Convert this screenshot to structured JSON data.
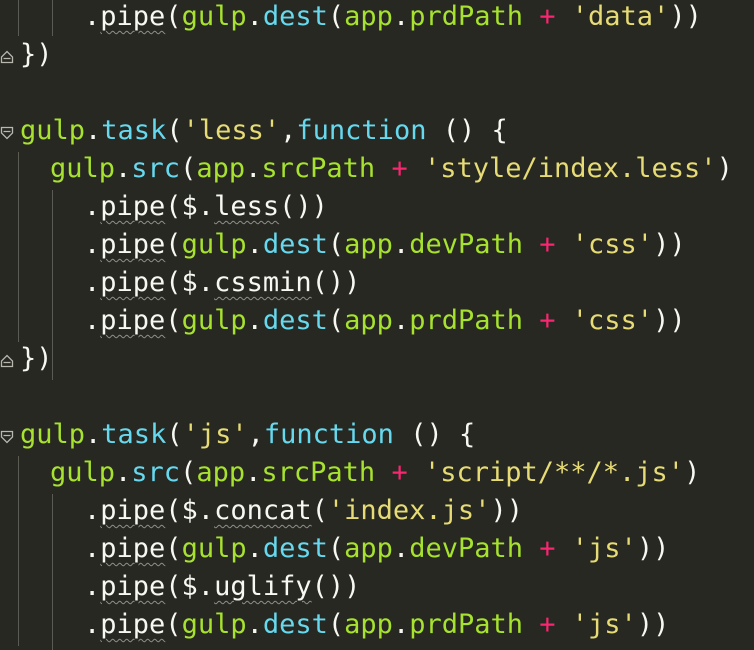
{
  "colors": {
    "background": "#272822",
    "identifier": "#a6e22e",
    "keyword": "#66d9ef",
    "string": "#e6db74",
    "operator": "#f92672",
    "plain": "#f8f8f2"
  },
  "lines": [
    [
      {
        "t": ".",
        "c": "plain"
      },
      {
        "t": "pipe",
        "c": "plain",
        "u": true
      },
      {
        "t": "(",
        "c": "plain"
      },
      {
        "t": "gulp",
        "c": "green"
      },
      {
        "t": ".",
        "c": "plain"
      },
      {
        "t": "dest",
        "c": "cyan"
      },
      {
        "t": "(",
        "c": "plain"
      },
      {
        "t": "app",
        "c": "green"
      },
      {
        "t": ".",
        "c": "plain"
      },
      {
        "t": "prdPath",
        "c": "green"
      },
      {
        "t": " + ",
        "c": "op"
      },
      {
        "t": "'data'",
        "c": "str"
      },
      {
        "t": "))",
        "c": "plain"
      }
    ],
    [
      {
        "t": "})",
        "c": "plain"
      }
    ],
    [],
    [
      {
        "t": "gulp",
        "c": "green"
      },
      {
        "t": ".",
        "c": "plain"
      },
      {
        "t": "task",
        "c": "cyan"
      },
      {
        "t": "(",
        "c": "plain"
      },
      {
        "t": "'less'",
        "c": "str"
      },
      {
        "t": ",",
        "c": "plain"
      },
      {
        "t": "function",
        "c": "cyan"
      },
      {
        "t": " () {",
        "c": "plain"
      }
    ],
    [
      {
        "t": "gulp",
        "c": "green"
      },
      {
        "t": ".",
        "c": "plain"
      },
      {
        "t": "src",
        "c": "cyan"
      },
      {
        "t": "(",
        "c": "plain"
      },
      {
        "t": "app",
        "c": "green"
      },
      {
        "t": ".",
        "c": "plain"
      },
      {
        "t": "srcPath",
        "c": "green"
      },
      {
        "t": " + ",
        "c": "op"
      },
      {
        "t": "'style/index.less'",
        "c": "str"
      },
      {
        "t": ")",
        "c": "plain"
      }
    ],
    [
      {
        "t": ".",
        "c": "plain"
      },
      {
        "t": "pipe",
        "c": "plain",
        "u": true
      },
      {
        "t": "($.",
        "c": "plain"
      },
      {
        "t": "less",
        "c": "plain",
        "u": true
      },
      {
        "t": "())",
        "c": "plain"
      }
    ],
    [
      {
        "t": ".",
        "c": "plain"
      },
      {
        "t": "pipe",
        "c": "plain",
        "u": true
      },
      {
        "t": "(",
        "c": "plain"
      },
      {
        "t": "gulp",
        "c": "green"
      },
      {
        "t": ".",
        "c": "plain"
      },
      {
        "t": "dest",
        "c": "cyan"
      },
      {
        "t": "(",
        "c": "plain"
      },
      {
        "t": "app",
        "c": "green"
      },
      {
        "t": ".",
        "c": "plain"
      },
      {
        "t": "devPath",
        "c": "green"
      },
      {
        "t": " + ",
        "c": "op"
      },
      {
        "t": "'css'",
        "c": "str"
      },
      {
        "t": "))",
        "c": "plain"
      }
    ],
    [
      {
        "t": ".",
        "c": "plain"
      },
      {
        "t": "pipe",
        "c": "plain",
        "u": true
      },
      {
        "t": "($.",
        "c": "plain"
      },
      {
        "t": "cssmin",
        "c": "plain",
        "u": true
      },
      {
        "t": "())",
        "c": "plain"
      }
    ],
    [
      {
        "t": ".",
        "c": "plain"
      },
      {
        "t": "pipe",
        "c": "plain",
        "u": true
      },
      {
        "t": "(",
        "c": "plain"
      },
      {
        "t": "gulp",
        "c": "green"
      },
      {
        "t": ".",
        "c": "plain"
      },
      {
        "t": "dest",
        "c": "cyan"
      },
      {
        "t": "(",
        "c": "plain"
      },
      {
        "t": "app",
        "c": "green"
      },
      {
        "t": ".",
        "c": "plain"
      },
      {
        "t": "prdPath",
        "c": "green"
      },
      {
        "t": " + ",
        "c": "op"
      },
      {
        "t": "'css'",
        "c": "str"
      },
      {
        "t": "))",
        "c": "plain"
      }
    ],
    [
      {
        "t": "})",
        "c": "plain"
      }
    ],
    [],
    [
      {
        "t": "gulp",
        "c": "green"
      },
      {
        "t": ".",
        "c": "plain"
      },
      {
        "t": "task",
        "c": "cyan"
      },
      {
        "t": "(",
        "c": "plain"
      },
      {
        "t": "'js'",
        "c": "str"
      },
      {
        "t": ",",
        "c": "plain"
      },
      {
        "t": "function",
        "c": "cyan"
      },
      {
        "t": " () {",
        "c": "plain"
      }
    ],
    [
      {
        "t": "gulp",
        "c": "green"
      },
      {
        "t": ".",
        "c": "plain"
      },
      {
        "t": "src",
        "c": "cyan"
      },
      {
        "t": "(",
        "c": "plain"
      },
      {
        "t": "app",
        "c": "green"
      },
      {
        "t": ".",
        "c": "plain"
      },
      {
        "t": "srcPath",
        "c": "green"
      },
      {
        "t": " + ",
        "c": "op"
      },
      {
        "t": "'script/**/*.js'",
        "c": "str"
      },
      {
        "t": ")",
        "c": "plain"
      }
    ],
    [
      {
        "t": ".",
        "c": "plain"
      },
      {
        "t": "pipe",
        "c": "plain",
        "u": true
      },
      {
        "t": "($.",
        "c": "plain"
      },
      {
        "t": "concat",
        "c": "plain",
        "u": true
      },
      {
        "t": "(",
        "c": "plain"
      },
      {
        "t": "'index.js'",
        "c": "str"
      },
      {
        "t": "))",
        "c": "plain"
      }
    ],
    [
      {
        "t": ".",
        "c": "plain"
      },
      {
        "t": "pipe",
        "c": "plain",
        "u": true
      },
      {
        "t": "(",
        "c": "plain"
      },
      {
        "t": "gulp",
        "c": "green"
      },
      {
        "t": ".",
        "c": "plain"
      },
      {
        "t": "dest",
        "c": "cyan"
      },
      {
        "t": "(",
        "c": "plain"
      },
      {
        "t": "app",
        "c": "green"
      },
      {
        "t": ".",
        "c": "plain"
      },
      {
        "t": "devPath",
        "c": "green"
      },
      {
        "t": " + ",
        "c": "op"
      },
      {
        "t": "'js'",
        "c": "str"
      },
      {
        "t": "))",
        "c": "plain"
      }
    ],
    [
      {
        "t": ".",
        "c": "plain"
      },
      {
        "t": "pipe",
        "c": "plain",
        "u": true
      },
      {
        "t": "($.",
        "c": "plain"
      },
      {
        "t": "uglify",
        "c": "plain",
        "u": true
      },
      {
        "t": "())",
        "c": "plain"
      }
    ],
    [
      {
        "t": ".",
        "c": "plain"
      },
      {
        "t": "pipe",
        "c": "plain",
        "u": true
      },
      {
        "t": "(",
        "c": "plain"
      },
      {
        "t": "gulp",
        "c": "green"
      },
      {
        "t": ".",
        "c": "plain"
      },
      {
        "t": "dest",
        "c": "cyan"
      },
      {
        "t": "(",
        "c": "plain"
      },
      {
        "t": "app",
        "c": "green"
      },
      {
        "t": ".",
        "c": "plain"
      },
      {
        "t": "prdPath",
        "c": "green"
      },
      {
        "t": " + ",
        "c": "op"
      },
      {
        "t": "'js'",
        "c": "str"
      },
      {
        "t": "))",
        "c": "plain"
      }
    ]
  ]
}
